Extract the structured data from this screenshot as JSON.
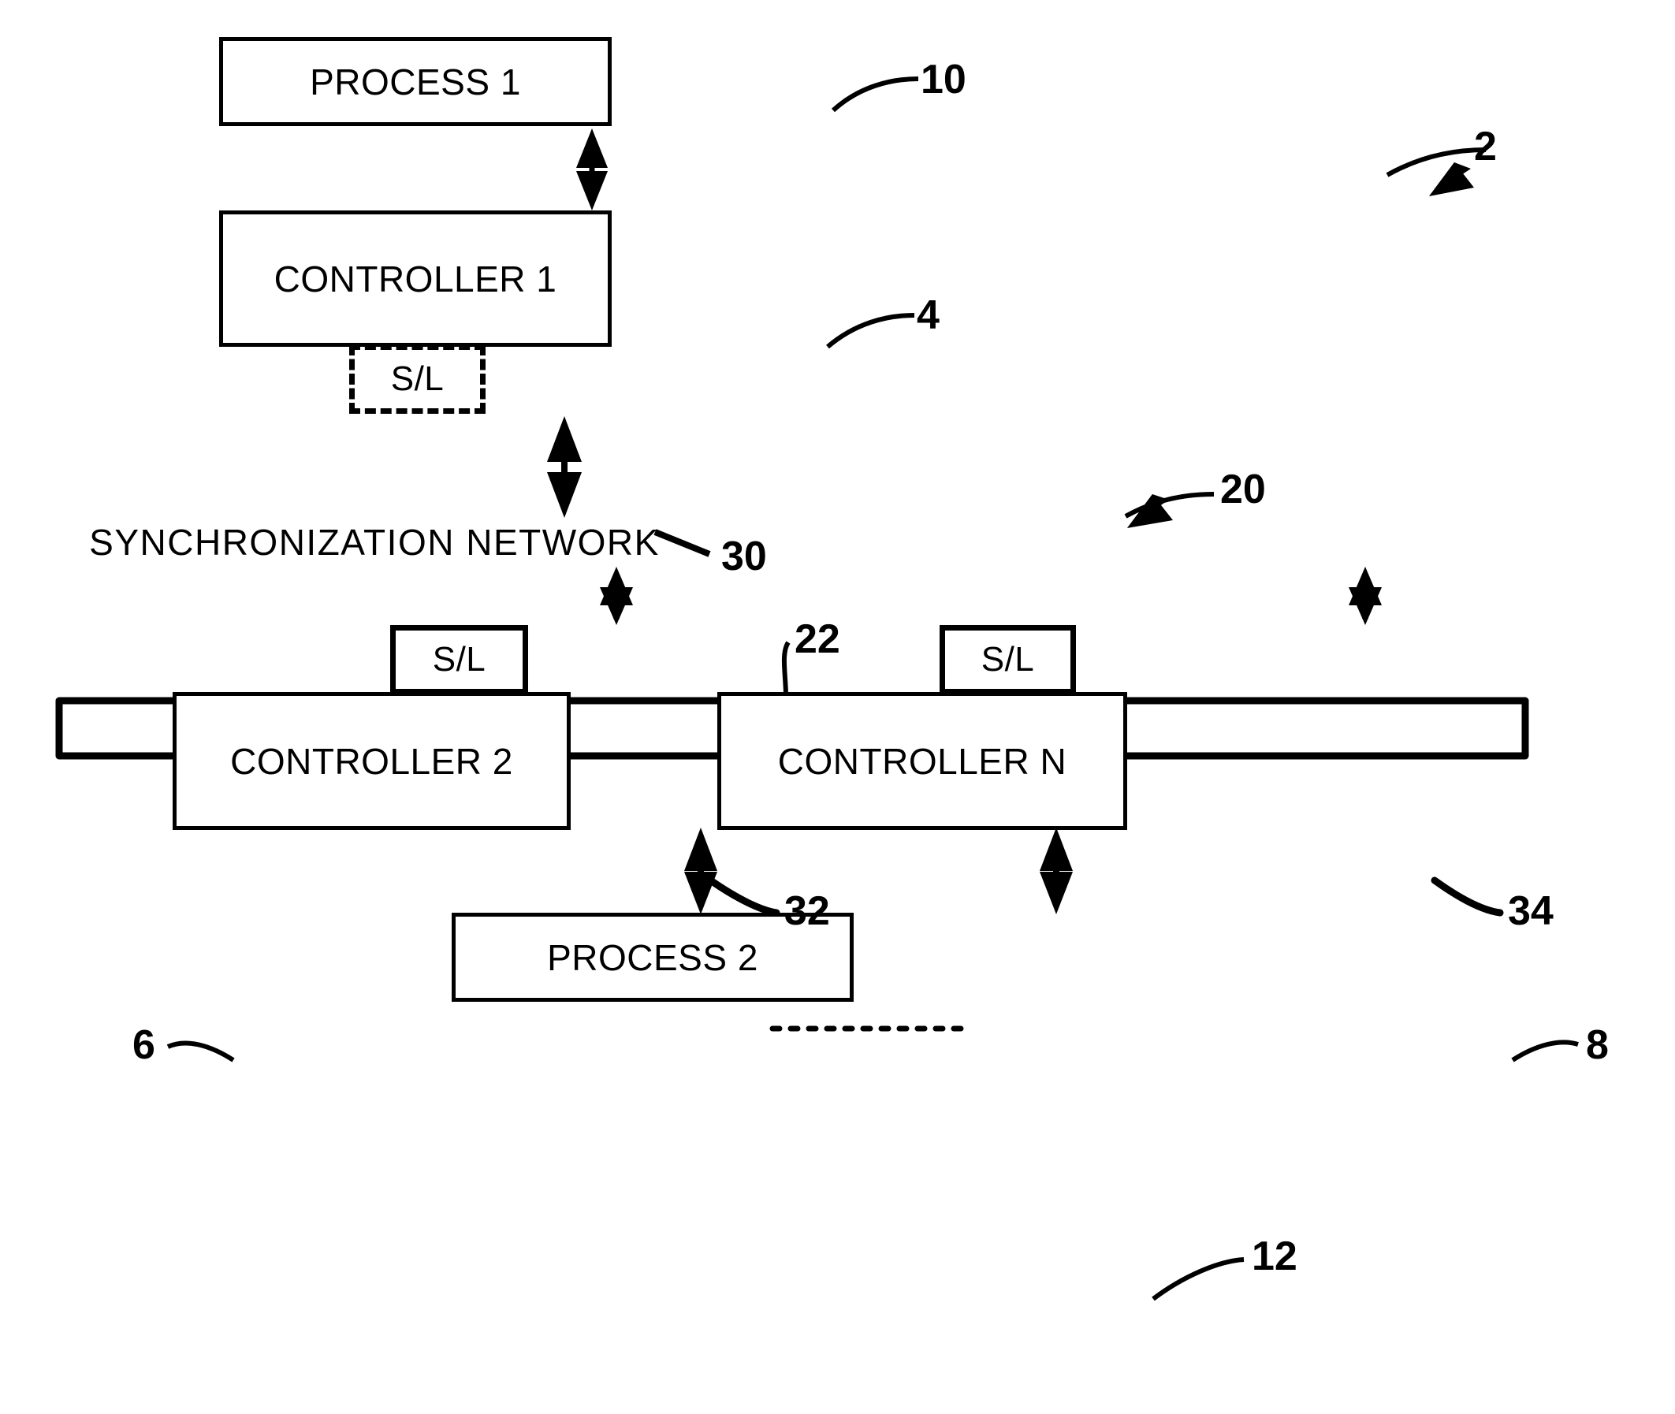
{
  "figure": {
    "type": "patent-block-diagram",
    "blocks": {
      "process1": "PROCESS 1",
      "controller1": "CONTROLLER 1",
      "sl30": "S/L",
      "network": "SYNCHRONIZATION NETWORK",
      "sl32": "S/L",
      "sl34": "S/L",
      "controller2": "CONTROLLER 2",
      "controllerN": "CONTROLLER N",
      "process2": "PROCESS 2"
    },
    "reference_numerals": {
      "system": "2",
      "controller1": "4",
      "controller2": "6",
      "controllerN": "8",
      "process1": "10",
      "process2": "12",
      "sync_subsystem": "20",
      "network": "22",
      "sl30": "30",
      "sl32": "32",
      "sl34": "34"
    },
    "connections": [
      "PROCESS 1 <-> CONTROLLER 1",
      "CONTROLLER 1 (S/L 30) <-> SYNCHRONIZATION NETWORK",
      "SYNCHRONIZATION NETWORK <-> S/L 32 (CONTROLLER 2)",
      "SYNCHRONIZATION NETWORK <-> S/L 34 (CONTROLLER N)",
      "CONTROLLER 2 <-> PROCESS 2",
      "CONTROLLER N <-> PROCESS 2",
      "CONTROLLER 2 ... CONTROLLER N"
    ],
    "colors": {
      "stroke": "#000000",
      "background": "#ffffff"
    }
  }
}
